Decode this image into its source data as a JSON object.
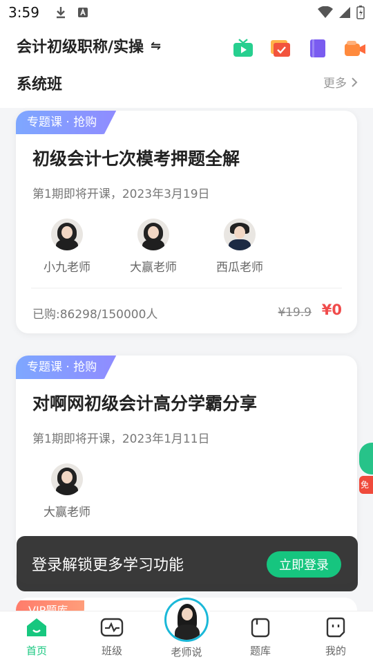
{
  "status": {
    "time": "3:59"
  },
  "header": {
    "exam": "会计初级职称/实操",
    "swap_symbol": "⇋",
    "section_title": "系统班",
    "more_label": "更多"
  },
  "cards": [
    {
      "tag": "专题课 · 抢购",
      "title": "初级会计七次模考押题全解",
      "date": "第1期即将开课，2023年3月19日",
      "teachers": [
        "小九老师",
        "大赢老师",
        "西瓜老师"
      ],
      "sold": "已购:86298/150000人",
      "old_price": "¥19.9",
      "price": "¥0"
    },
    {
      "tag": "专题课 · 抢购",
      "title": "对啊网初级会计高分学霸分享",
      "date": "第1期即将开课，2023年1月11日",
      "teachers": [
        "大赢老师"
      ]
    }
  ],
  "side_badge": "免费",
  "login_banner": {
    "text": "登录解锁更多学习功能",
    "button": "立即登录"
  },
  "vip_tag": "VIP题库",
  "nav": {
    "home": "首页",
    "class": "班级",
    "teacher": "老师说",
    "bank": "题库",
    "mine": "我的"
  }
}
